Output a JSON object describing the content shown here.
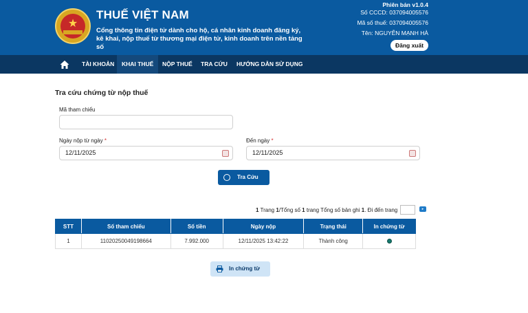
{
  "header": {
    "title": "THUẾ VIỆT NAM",
    "subtitle_line1": "Cổng thông tin điện tử dành cho hộ, cá nhân kinh doanh đăng ký,",
    "subtitle_line2": "kê khai, nộp thuế từ thương mại điện tử, kinh doanh trên nền tảng số",
    "version": "Phiên bản v1.0.4",
    "cccd": "Số CCCD: 037094005576",
    "tax_code": "Mã số thuế: 037094005576",
    "name": "Tên: NGUYỄN MẠNH HÀ",
    "logout_label": "Đăng xuất"
  },
  "nav": {
    "items": [
      {
        "label": "TÀI KHOẢN"
      },
      {
        "label": "KHAI THUẾ"
      },
      {
        "label": "NỘP THUẾ"
      },
      {
        "label": "TRA CỨU"
      },
      {
        "label": "HƯỚNG DẪN SỬ DỤNG"
      }
    ]
  },
  "form": {
    "title": "Tra cứu chứng từ nộp thuế",
    "ref_label": "Mã tham chiếu",
    "ref_value": "",
    "from_label": "Ngày nộp từ ngày",
    "from_value": "12/11/2025",
    "to_label": "Đến ngày",
    "to_value": "12/11/2025",
    "required_mark": "*",
    "search_label": "Tra Cứu"
  },
  "pager": {
    "current": "1",
    "text_trang": " Trang ",
    "total_pages": "1",
    "text_tong": "/Tổng số ",
    "total_pages2": "1",
    "text_trang2": " trang Tổng số bản ghi ",
    "total_records": "1",
    "text_goto": ". Đi đến trang"
  },
  "table": {
    "headers": [
      "STT",
      "Số tham chiếu",
      "Số tiền",
      "Ngày nộp",
      "Trạng thái",
      "In chứng từ"
    ],
    "rows": [
      [
        "1",
        "11020250049198664",
        "7.992.000",
        "12/11/2025 13:42:22",
        "Thành công"
      ]
    ]
  },
  "print_label": "In chứng từ",
  "colors": {
    "header_bg": "#0a5aa0",
    "nav_bg": "#0b3762",
    "primary": "#0a5aa0"
  }
}
